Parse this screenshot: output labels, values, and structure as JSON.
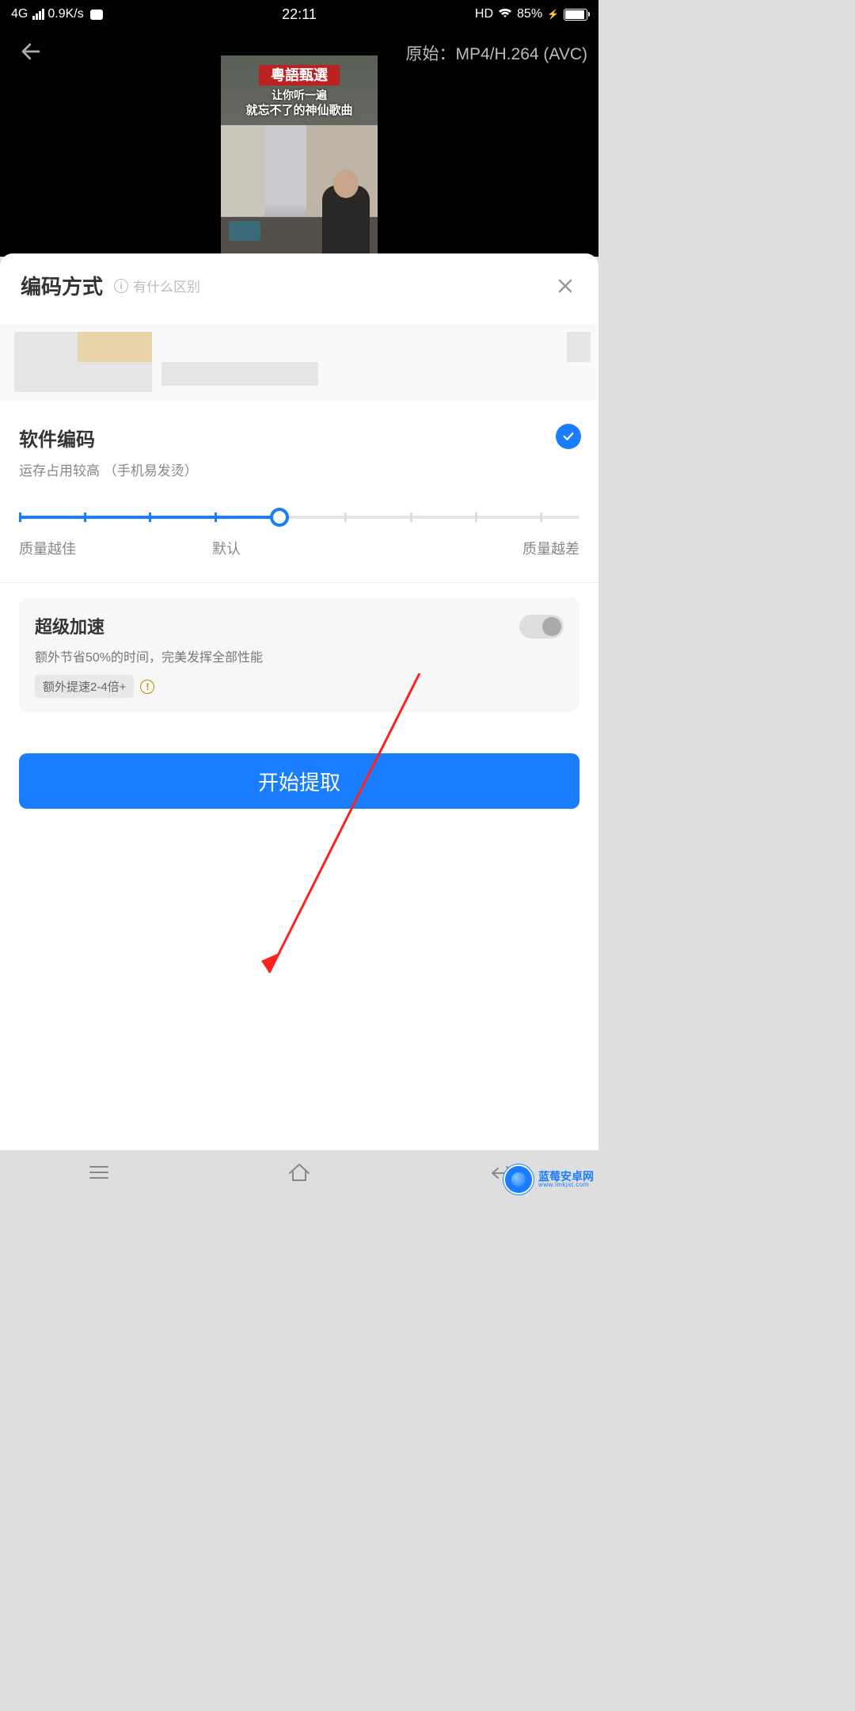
{
  "statusBar": {
    "network": "4G",
    "speed": "0.9K/s",
    "time": "22:11",
    "hd": "HD",
    "battery": "85%"
  },
  "header": {
    "formatPrefix": "原始：",
    "format": "MP4/H.264 (AVC)"
  },
  "videoThumb": {
    "title": "粵語甄選",
    "sub1": "让你听一遍",
    "sub2": "就忘不了的神仙歌曲"
  },
  "sheet": {
    "title": "编码方式",
    "helpText": "有什么区别"
  },
  "encoding": {
    "title": "软件编码",
    "subtitle": "运存占用较高 （手机易发烫）"
  },
  "slider": {
    "leftLabel": "质量越佳",
    "midLabel": "默认",
    "rightLabel": "质量越差"
  },
  "boost": {
    "title": "超级加速",
    "subtitle": "额外节省50%的时间，完美发挥全部性能",
    "tag": "额外提速2-4倍+"
  },
  "primaryButton": "开始提取",
  "watermark": {
    "name": "蓝莓安卓网",
    "url": "www.lmkjst.com"
  }
}
